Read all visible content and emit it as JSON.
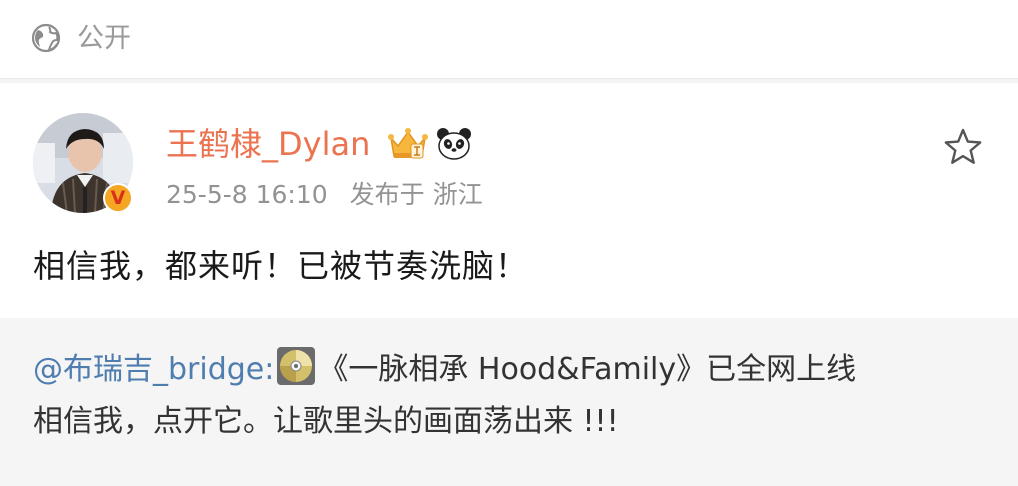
{
  "visibility": {
    "icon": "globe-icon",
    "label": "公开"
  },
  "post": {
    "author": {
      "name": "王鹤棣_Dylan",
      "avatar": "avatar",
      "verified_badge": "V",
      "badges": [
        "crown-badge-icon",
        "panda-icon"
      ]
    },
    "timestamp": "25-5-8 16:10",
    "location_prefix": "发布于",
    "location": "浙江",
    "text": "相信我，都来听！已被节奏洗脑！",
    "favorite_icon": "star-icon"
  },
  "repost": {
    "mention": "@布瑞吉_bridge",
    "colon": ":",
    "disc_icon": "cd-disc-icon",
    "line1_rest": "《一脉相承 Hood&Family》已全网上线",
    "line2": "相信我，点开它。让歌里头的画面荡出来 !!!"
  },
  "colors": {
    "username": "#eb7350",
    "mention": "#507daf",
    "meta": "#939393",
    "repost_background": "#f5f5f5"
  }
}
